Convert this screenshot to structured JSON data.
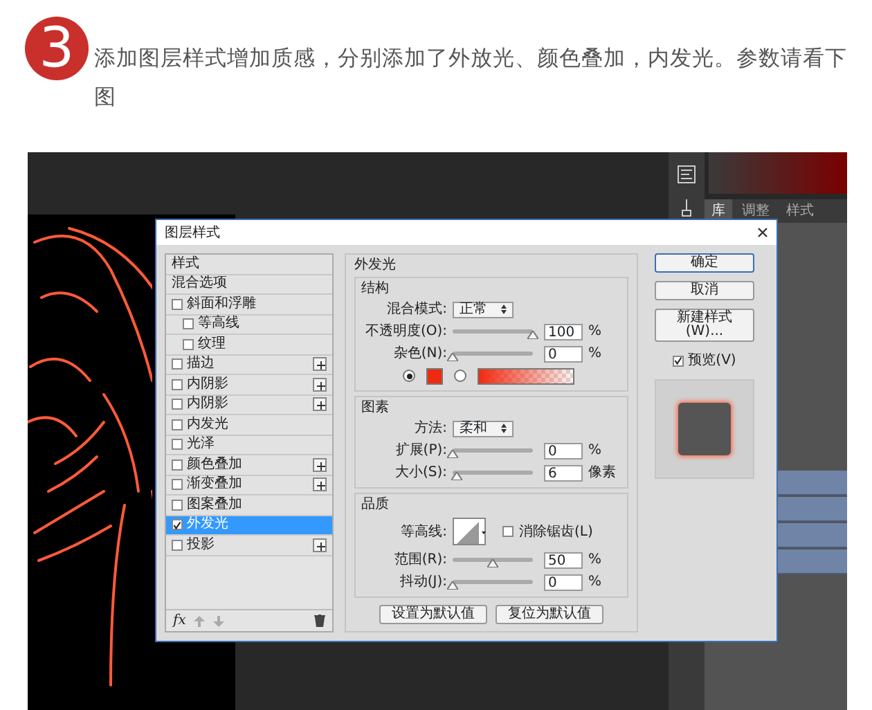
{
  "step": {
    "number": "3",
    "text": "添加图层样式增加质感，分别添加了外放光、颜色叠加，内发光。参数请看下图"
  },
  "ps_panel": {
    "tabs": [
      {
        "label": "库",
        "selected": true
      },
      {
        "label": "调整",
        "selected": false
      },
      {
        "label": "样式",
        "selected": false
      }
    ]
  },
  "dialog": {
    "title": "图层样式",
    "styles": [
      {
        "label": "样式",
        "kind": "header",
        "selected": false
      },
      {
        "label": "混合选项",
        "kind": "header",
        "selected": false
      },
      {
        "label": "斜面和浮雕",
        "kind": "check",
        "checked": false,
        "add": false,
        "selected": false,
        "children": [
          {
            "label": "等高线",
            "kind": "check",
            "checked": false,
            "add": false,
            "selected": false
          },
          {
            "label": "纹理",
            "kind": "check",
            "checked": false,
            "add": false,
            "selected": false
          }
        ]
      },
      {
        "label": "描边",
        "kind": "check",
        "checked": false,
        "add": true,
        "selected": false
      },
      {
        "label": "内阴影",
        "kind": "check",
        "checked": false,
        "add": true,
        "selected": false
      },
      {
        "label": "内阴影",
        "kind": "check",
        "checked": false,
        "add": true,
        "selected": false
      },
      {
        "label": "内发光",
        "kind": "check",
        "checked": false,
        "add": false,
        "selected": false
      },
      {
        "label": "光泽",
        "kind": "check",
        "checked": false,
        "add": false,
        "selected": false
      },
      {
        "label": "颜色叠加",
        "kind": "check",
        "checked": false,
        "add": true,
        "selected": false
      },
      {
        "label": "渐变叠加",
        "kind": "check",
        "checked": false,
        "add": true,
        "selected": false
      },
      {
        "label": "图案叠加",
        "kind": "check",
        "checked": false,
        "add": false,
        "selected": false
      },
      {
        "label": "外发光",
        "kind": "check",
        "checked": true,
        "add": false,
        "selected": true
      },
      {
        "label": "投影",
        "kind": "check",
        "checked": false,
        "add": true,
        "selected": false
      }
    ],
    "fx_label": "fx",
    "section_title": "外发光",
    "groups": [
      {
        "title": "结构",
        "rows": [
          {
            "kind": "select",
            "label": "混合模式:",
            "value": "正常"
          },
          {
            "kind": "slider",
            "label": "不透明度(O):",
            "level": 1,
            "value": "100",
            "unit": "%"
          },
          {
            "kind": "slider",
            "label": "杂色(N):",
            "level": 0,
            "value": "0",
            "unit": "%"
          },
          {
            "kind": "color",
            "color_selected": true,
            "color": "#f02a10",
            "gradient_selected": false
          }
        ]
      },
      {
        "title": "图素",
        "rows": [
          {
            "kind": "select",
            "label": "方法:",
            "value": "柔和"
          },
          {
            "kind": "slider",
            "label": "扩展(P):",
            "level": 0,
            "value": "0",
            "unit": "%"
          },
          {
            "kind": "slider",
            "label": "大小(S):",
            "level": 0.06,
            "value": "6",
            "unit": "像素"
          }
        ]
      },
      {
        "title": "品质",
        "rows": [
          {
            "kind": "contour",
            "label": "等高线:",
            "check_label": "消除锯齿(L)",
            "checked": false
          },
          {
            "kind": "slider",
            "label": "范围(R):",
            "level": 0.5,
            "value": "50",
            "unit": "%"
          },
          {
            "kind": "slider",
            "label": "抖动(J):",
            "level": 0,
            "value": "0",
            "unit": "%"
          }
        ]
      }
    ],
    "default_buttons": [
      "设置为默认值",
      "复位为默认值"
    ],
    "buttons": [
      {
        "label": "确定",
        "primary": true
      },
      {
        "label": "取消",
        "primary": false
      },
      {
        "label": "新建样式(W)...",
        "primary": false
      }
    ],
    "preview": {
      "label": "预览(V)",
      "checked": true
    }
  }
}
